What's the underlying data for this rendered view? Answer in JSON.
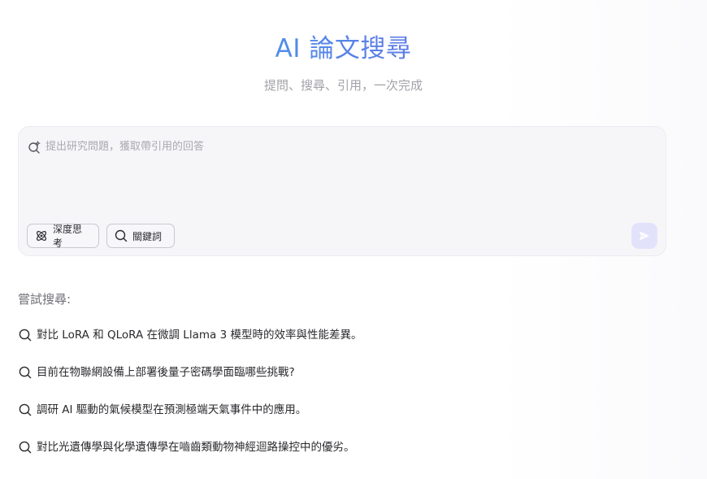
{
  "header": {
    "title": "AI 論文搜尋",
    "subtitle": "提問、搜尋、引用，一次完成"
  },
  "search": {
    "placeholder": "提出研究問題，獲取帶引用的回答",
    "options": [
      {
        "label": "深度思考",
        "icon": "atom-icon"
      },
      {
        "label": "關鍵詞",
        "icon": "search-icon"
      }
    ],
    "send_icon": "send-icon"
  },
  "suggestions": {
    "label": "嘗試搜尋:",
    "items": [
      "對比 LoRA 和 QLoRA 在微調 Llama 3 模型時的效率與性能差異。",
      "目前在物聯網設備上部署後量子密碼學面臨哪些挑戰?",
      "調研 AI 驅動的氣候模型在預測極端天氣事件中的應用。",
      "對比光遺傳學與化學遺傳學在嚙齒類動物神經迴路操控中的優劣。"
    ]
  },
  "colors": {
    "title_gradient_start": "#35b6f1",
    "title_gradient_end": "#6a6ee2",
    "send_button_bg": "#e2e3fb",
    "send_icon": "#ffffff"
  }
}
